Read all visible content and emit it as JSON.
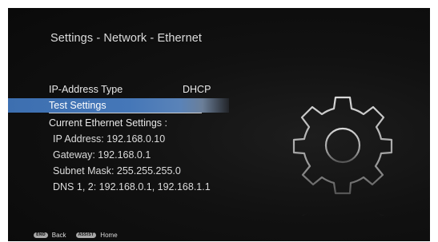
{
  "screen": {
    "title": "Settings - Network - Ethernet"
  },
  "menu": {
    "ip_address_type_label": "IP-Address Type",
    "ip_address_type_value": "DHCP",
    "test_settings_label": "Test Settings",
    "current_settings_heading": "Current Ethernet Settings :"
  },
  "details": {
    "ip_address": "IP Address: 192.168.0.10",
    "gateway": "Gateway: 192.168.0.1",
    "subnet_mask": "Subnet Mask: 255.255.255.0",
    "dns": "DNS 1, 2: 192.168.0.1, 192.168.1.1"
  },
  "footer": {
    "back_key": "END",
    "back_label": "Back",
    "home_key": "ASSIST",
    "home_label": "Home"
  },
  "colors": {
    "background": "#111111",
    "highlight": "#4577b8",
    "text": "#e8e8e8"
  },
  "icons": {
    "decoration": "gear-icon"
  }
}
